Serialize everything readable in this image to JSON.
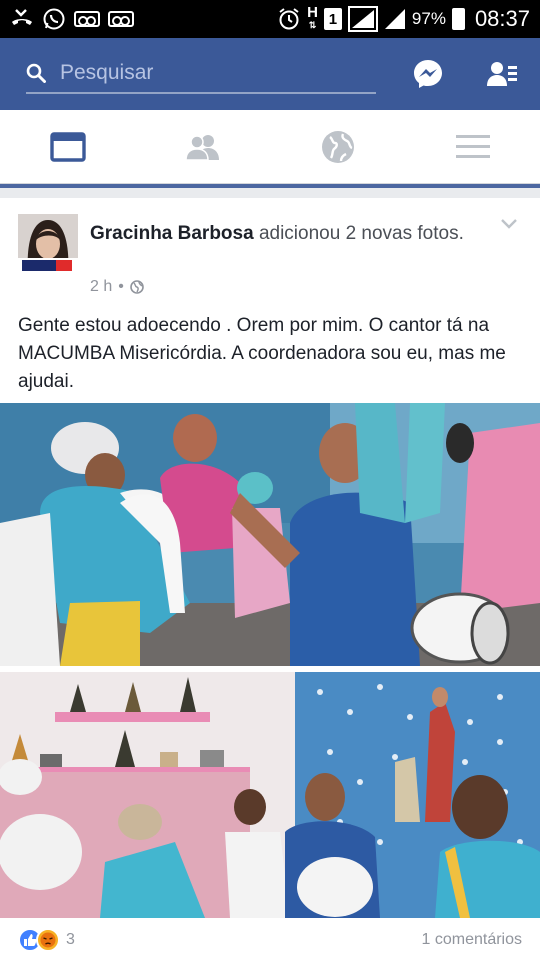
{
  "status_bar": {
    "battery_percent": "97%",
    "clock": "08:37",
    "sim_label": "1",
    "network_label": "H",
    "icons": [
      "missed-call-icon",
      "whatsapp-icon",
      "voicemail-icon",
      "voicemail-icon",
      "alarm-icon",
      "network-h-icon",
      "sim-icon",
      "signal-icon",
      "signal-icon",
      "battery-icon"
    ]
  },
  "header": {
    "search_placeholder": "Pesquisar",
    "icons": [
      "search-icon",
      "messenger-icon",
      "friend-requests-icon"
    ],
    "accent": "#3b5998"
  },
  "tabs": [
    {
      "name": "news-feed",
      "icon": "news-feed-icon",
      "active": true
    },
    {
      "name": "friends",
      "icon": "friends-icon",
      "active": false
    },
    {
      "name": "notifications",
      "icon": "globe-icon",
      "active": false
    },
    {
      "name": "menu",
      "icon": "menu-icon",
      "active": false
    }
  ],
  "post": {
    "author": "Gracinha Barbosa",
    "action": " adicionou 2 novas fotos.",
    "time": "2 h",
    "separator": "•",
    "avatar_badge": "IRANI 15",
    "text": "Gente estou adoecendo . Orem por mim. O cantor tá na MACUMBA Misericórdia. A coordenadora sou eu, mas me ajudai.",
    "reactions_count": "3",
    "comments": "1 comentários"
  }
}
